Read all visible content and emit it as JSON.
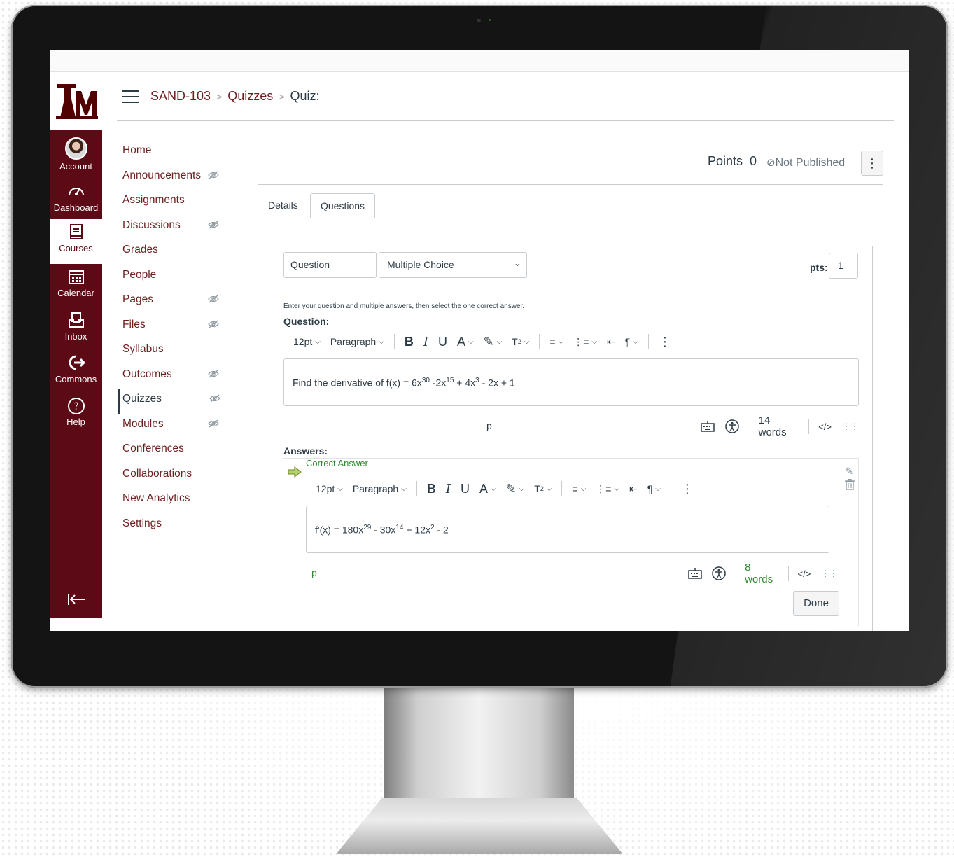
{
  "header": {
    "breadcrumb": [
      "SAND-103",
      "Quizzes",
      "Quiz:"
    ],
    "logo": "ĀṀ"
  },
  "global_nav": [
    {
      "label": "Account",
      "icon": "avatar-icon"
    },
    {
      "label": "Dashboard",
      "icon": "speedometer-icon"
    },
    {
      "label": "Courses",
      "icon": "book-icon",
      "active": true
    },
    {
      "label": "Calendar",
      "icon": "calendar-icon"
    },
    {
      "label": "Inbox",
      "icon": "inbox-icon"
    },
    {
      "label": "Commons",
      "icon": "commons-icon"
    },
    {
      "label": "Help",
      "icon": "help-icon"
    }
  ],
  "course_nav": [
    {
      "label": "Home",
      "hidden": false
    },
    {
      "label": "Announcements",
      "hidden": true
    },
    {
      "label": "Assignments",
      "hidden": false
    },
    {
      "label": "Discussions",
      "hidden": true
    },
    {
      "label": "Grades",
      "hidden": false
    },
    {
      "label": "People",
      "hidden": false
    },
    {
      "label": "Pages",
      "hidden": true
    },
    {
      "label": "Files",
      "hidden": true
    },
    {
      "label": "Syllabus",
      "hidden": false
    },
    {
      "label": "Outcomes",
      "hidden": true
    },
    {
      "label": "Quizzes",
      "hidden": true,
      "active": true
    },
    {
      "label": "Modules",
      "hidden": true
    },
    {
      "label": "Conferences",
      "hidden": false
    },
    {
      "label": "Collaborations",
      "hidden": false
    },
    {
      "label": "New Analytics",
      "hidden": false
    },
    {
      "label": "Settings",
      "hidden": false
    }
  ],
  "quiz": {
    "points_label": "Points",
    "points_value": "0",
    "status": "Not Published",
    "tabs": [
      "Details",
      "Questions"
    ],
    "active_tab": "Questions"
  },
  "question": {
    "name": "Question",
    "type": "Multiple Choice",
    "pts_label": "pts:",
    "pts_value": "1",
    "instructions": "Enter your question and multiple answers, then select the one correct answer.",
    "label": "Question:",
    "toolbar": {
      "font_size": "12pt",
      "block": "Paragraph"
    },
    "text_prefix": "Find the derivative of f(x) = 6x",
    "sup1": "30",
    "text_mid1": " -2x",
    "sup2": "15",
    "text_mid2": " + 4x",
    "sup3": "3",
    "text_end": " - 2x + 1",
    "status_path": "p",
    "word_count": "14 words",
    "html_toggle": "</>"
  },
  "answers": {
    "label": "Answers:",
    "correct_label": "Correct Answer",
    "toolbar": {
      "font_size": "12pt",
      "block": "Paragraph"
    },
    "text_prefix": "f'(x) = 180x",
    "sup1": "29",
    "text_mid1": " - 30x",
    "sup2": "14",
    "text_mid2": " + 12x",
    "sup3": "2",
    "text_end": " - 2",
    "status_path": "p",
    "word_count": "8 words",
    "html_toggle": "</>",
    "done_label": "Done"
  },
  "colors": {
    "brand": "#5c0a15",
    "link": "#6d1e1e",
    "text": "#2d3b45",
    "correct": "#2f8a2f"
  }
}
